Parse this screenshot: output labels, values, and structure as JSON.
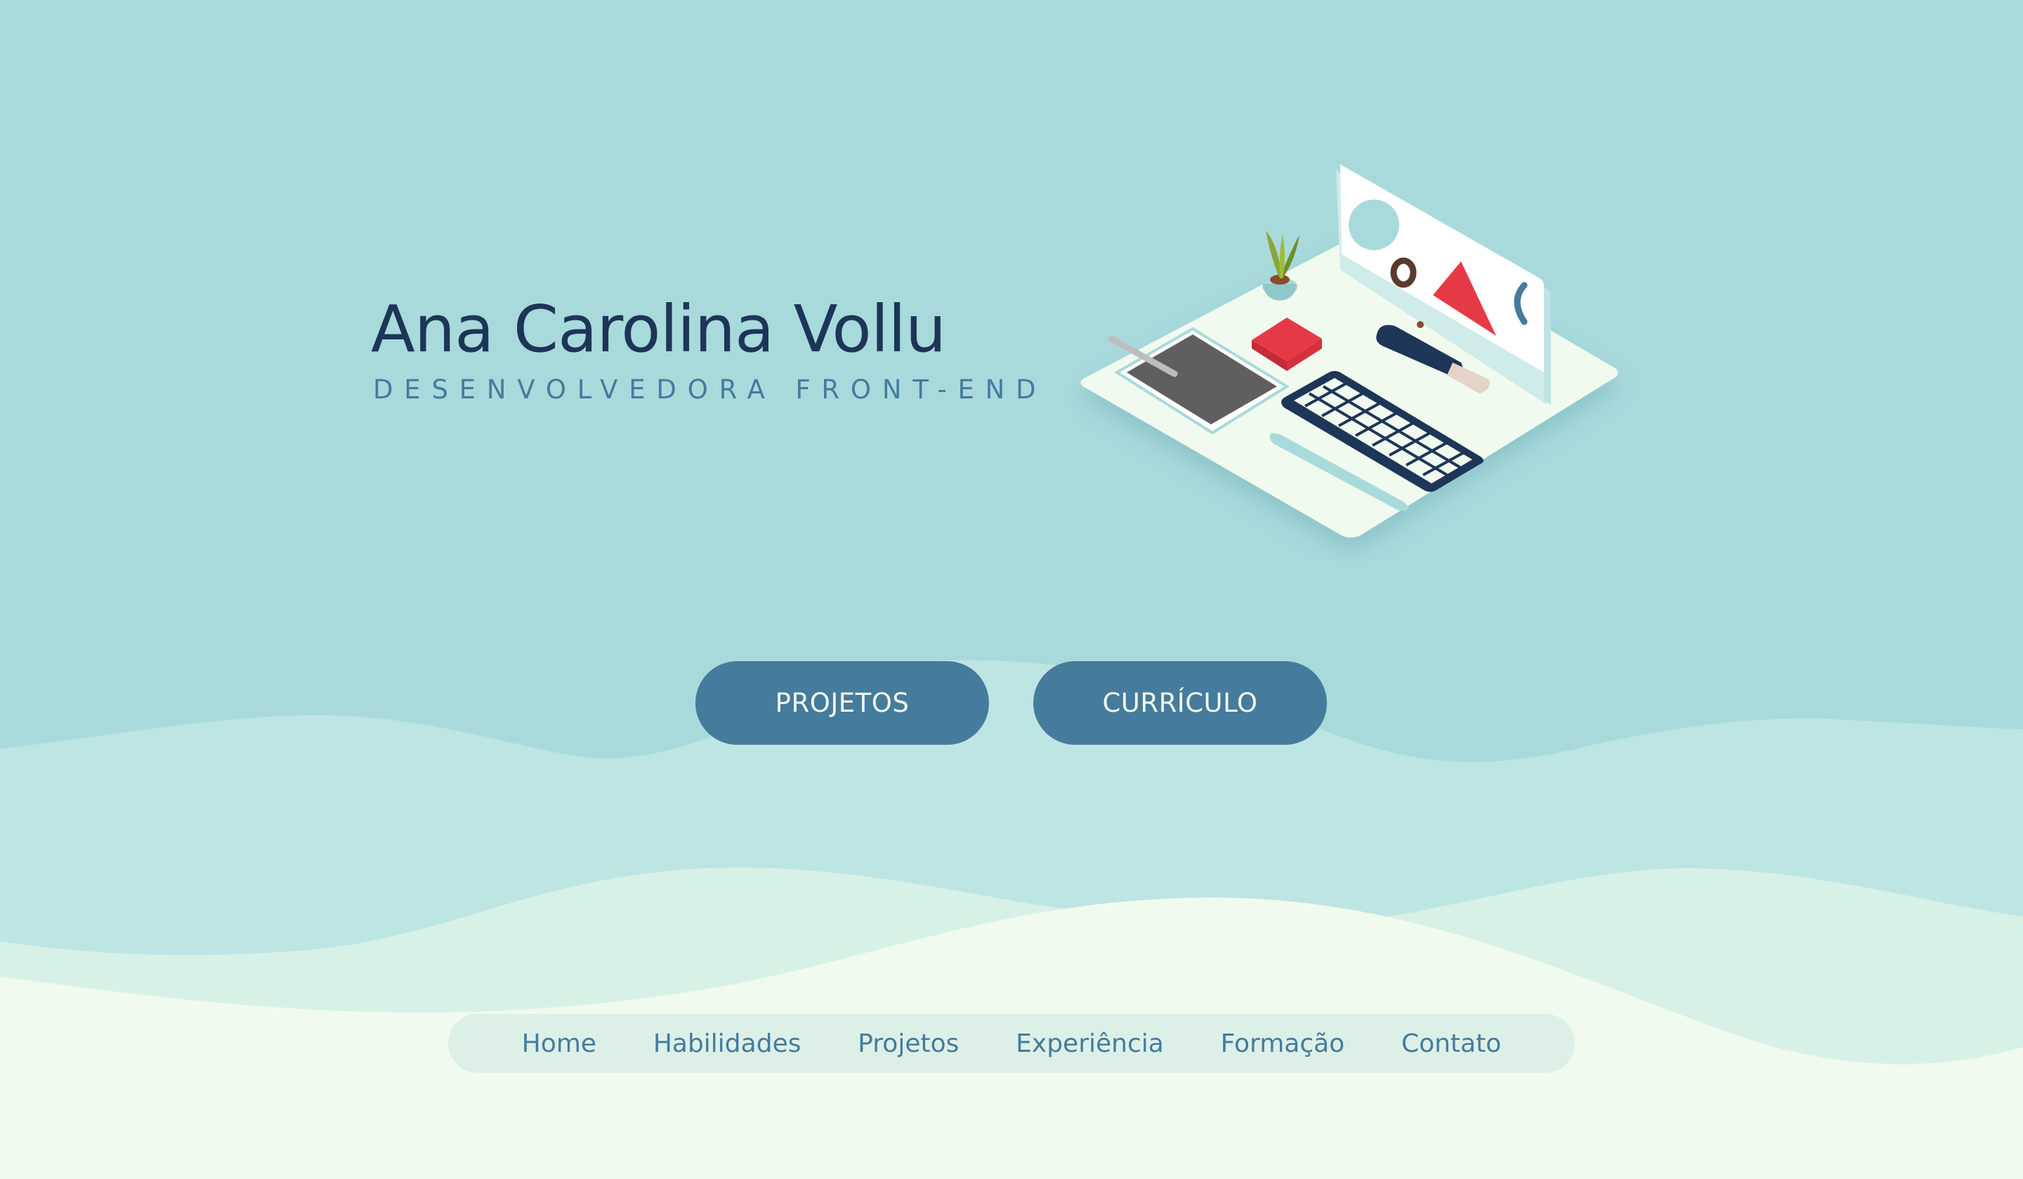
{
  "hero": {
    "name": "Ana Carolina Vollu",
    "role": "DESENVOLVEDORA FRONT-END"
  },
  "buttons": {
    "projects_label": "PROJETOS",
    "resume_label": "CURRÍCULO"
  },
  "nav": {
    "items": [
      {
        "label": "Home"
      },
      {
        "label": "Habilidades"
      },
      {
        "label": "Projetos"
      },
      {
        "label": "Experiência"
      },
      {
        "label": "Formação"
      },
      {
        "label": "Contato"
      }
    ]
  },
  "illustration": {
    "icon": "workspace-illustration"
  },
  "colors": {
    "background": "#a8dadc",
    "dark_navy": "#1d3557",
    "steel_blue": "#457b9d",
    "accent_red": "#e63946",
    "honeydew": "#f1faee"
  }
}
